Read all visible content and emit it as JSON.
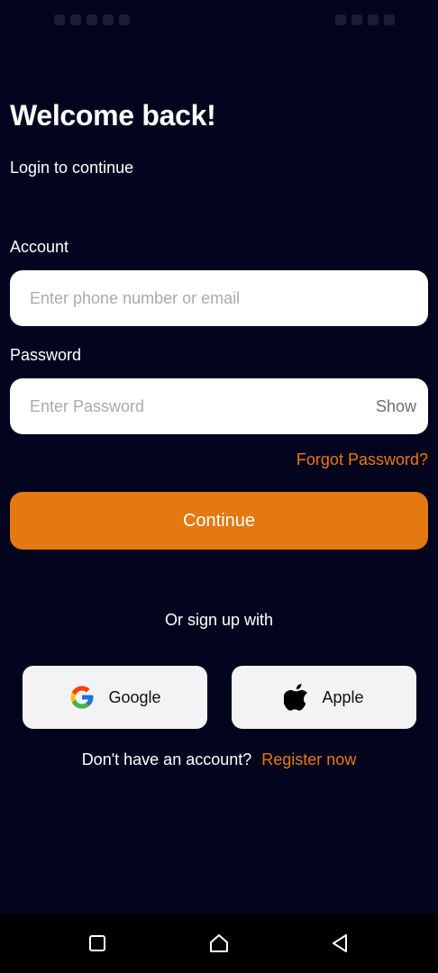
{
  "header": {
    "title": "Welcome back!",
    "subtitle": "Login to continue"
  },
  "account": {
    "label": "Account",
    "placeholder": "Enter phone number or email",
    "value": ""
  },
  "password": {
    "label": "Password",
    "placeholder": "Enter Password",
    "value": "",
    "toggle_label": "Show"
  },
  "forgot_label": "Forgot Password?",
  "continue_label": "Continue",
  "social": {
    "heading": "Or sign up with",
    "google_label": "Google",
    "apple_label": "Apple",
    "google_icon": "google-icon",
    "apple_icon": "apple-icon"
  },
  "register": {
    "prompt": "Don't have an account?",
    "link_label": "Register now"
  },
  "nav": {
    "recents_icon": "square-icon",
    "home_icon": "home-icon",
    "back_icon": "back-triangle-icon"
  },
  "colors": {
    "background": "#03051f",
    "accent": "#e47811",
    "field": "#ffffff",
    "social_button": "#f3f3f5"
  }
}
